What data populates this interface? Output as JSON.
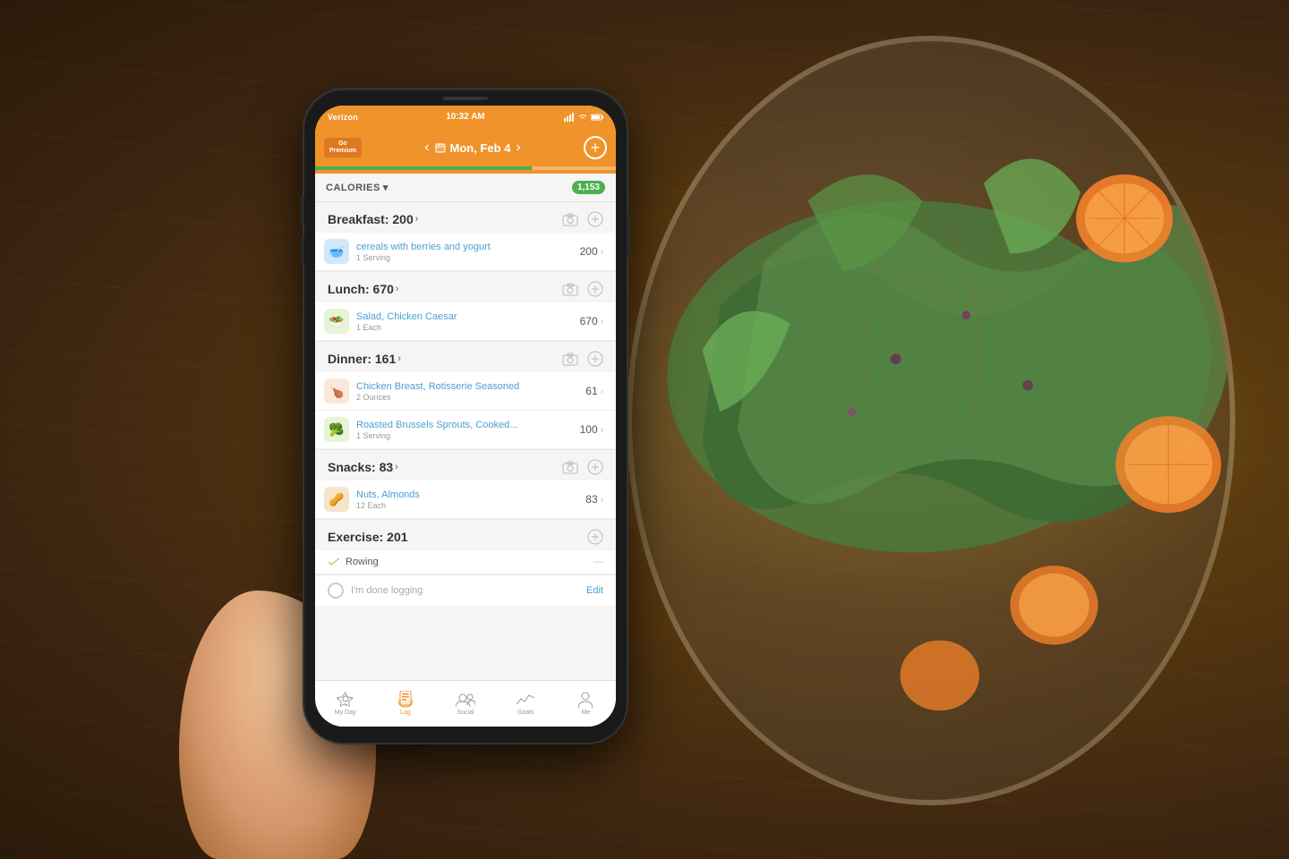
{
  "background": {
    "color": "#3d2510"
  },
  "phone": {
    "status_bar": {
      "carrier": "Verizon",
      "time": "10:32 AM",
      "icons": [
        "signal",
        "wifi",
        "battery"
      ]
    },
    "nav": {
      "premium_label": "Go\nPremium",
      "date": "Mon, Feb 4",
      "prev_arrow": "‹",
      "next_arrow": "›",
      "add_button": "+"
    },
    "calories_header": {
      "label": "CALORIES",
      "chevron": "▾",
      "total": "1,153"
    },
    "sections": [
      {
        "id": "breakfast",
        "title": "Breakfast: 200",
        "items": [
          {
            "name": "cereals with berries and yogurt",
            "serving": "1 Serving",
            "calories": "200",
            "icon": "🥣",
            "icon_bg": "#5b9bd5"
          }
        ]
      },
      {
        "id": "lunch",
        "title": "Lunch: 670",
        "items": [
          {
            "name": "Salad, Chicken Caesar",
            "serving": "1 Each",
            "calories": "670",
            "icon": "🥗",
            "icon_bg": "#8dc63f"
          }
        ]
      },
      {
        "id": "dinner",
        "title": "Dinner: 161",
        "items": [
          {
            "name": "Chicken Breast, Rotisserie Seasoned",
            "serving": "2 Ounces",
            "calories": "61",
            "icon": "🍗",
            "icon_bg": "#d4824c"
          },
          {
            "name": "Roasted Brussels Sprouts, Cooked...",
            "serving": "1 Serving",
            "calories": "100",
            "icon": "🥦",
            "icon_bg": "#8dc63f"
          }
        ]
      },
      {
        "id": "snacks",
        "title": "Snacks: 83",
        "items": [
          {
            "name": "Nuts, Almonds",
            "serving": "12 Each",
            "calories": "83",
            "icon": "🥜",
            "icon_bg": "#c97a3a"
          }
        ]
      }
    ],
    "exercise": {
      "title": "Exercise: 201",
      "item": "Rowing"
    },
    "done_logging": {
      "text": "I'm done logging",
      "edit_label": "Edit"
    },
    "tabs": [
      {
        "id": "my-day",
        "label": "My Day",
        "icon": "sun",
        "active": false
      },
      {
        "id": "log",
        "label": "Log",
        "icon": "clipboard",
        "active": true
      },
      {
        "id": "social",
        "label": "Social",
        "icon": "people",
        "active": false
      },
      {
        "id": "goals",
        "label": "Goals",
        "icon": "chart",
        "active": false
      },
      {
        "id": "me",
        "label": "Me",
        "icon": "person",
        "active": false
      }
    ]
  }
}
